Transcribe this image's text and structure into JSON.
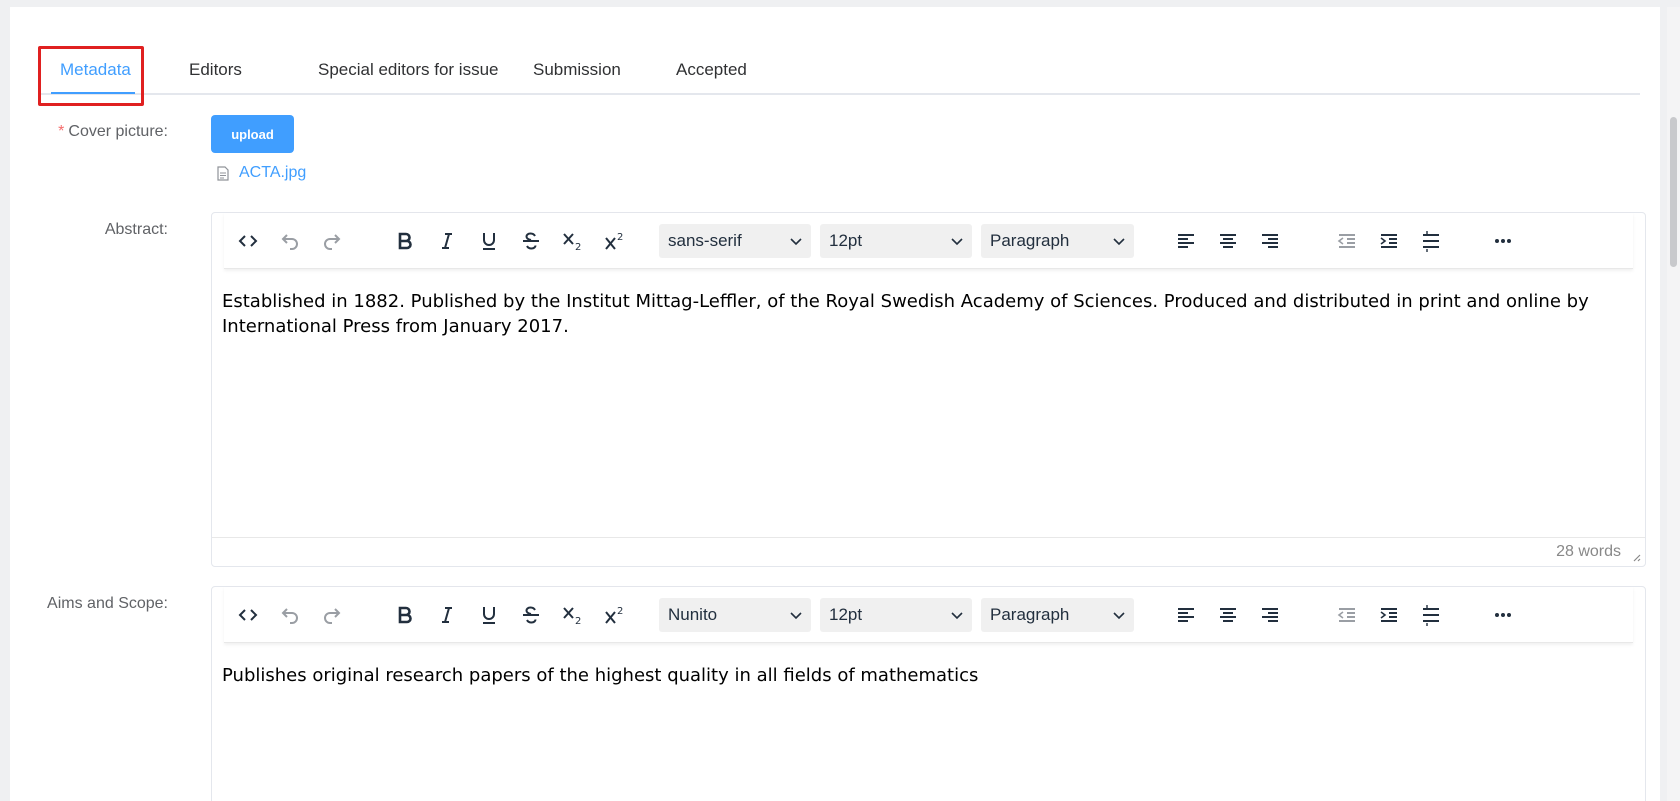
{
  "tabs": [
    {
      "label": "Metadata",
      "active": true
    },
    {
      "label": "Editors"
    },
    {
      "label": "Special editors for issue"
    },
    {
      "label": "Submission"
    },
    {
      "label": "Accepted"
    }
  ],
  "form": {
    "cover_label": "Cover picture:",
    "required_mark": "*",
    "upload_label": "upload",
    "file_name": "ACTA.jpg",
    "abstract_label": "Abstract:",
    "aims_label": "Aims and Scope:"
  },
  "abstract_editor": {
    "font": "sans-serif",
    "size": "12pt",
    "block": "Paragraph",
    "content": "Established in 1882. Published by the Institut Mittag-Leffler, of the Royal Swedish Academy of Sciences. Produced and distributed in print and online by International Press from January 2017.",
    "word_count": "28 words"
  },
  "aims_editor": {
    "font": "Nunito",
    "size": "12pt",
    "block": "Paragraph",
    "content": "Publishes original research papers of the highest quality in all fields of mathematics"
  },
  "colors": {
    "accent": "#409eff",
    "highlight": "#e02020",
    "required": "#f56c6c"
  }
}
